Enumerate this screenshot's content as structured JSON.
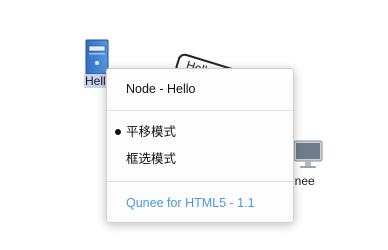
{
  "graph": {
    "server_node": {
      "icon": "server-icon",
      "label": "Hell"
    },
    "tag_node": {
      "text": "Hello"
    },
    "monitor_node": {
      "icon": "monitor-icon",
      "label": "unee"
    }
  },
  "context_menu": {
    "title_item": "Node - Hello",
    "items": [
      {
        "label": "平移模式",
        "selected": true
      },
      {
        "label": "框选模式",
        "selected": false
      }
    ],
    "version_item": "Qunee for HTML5 - 1.1"
  },
  "colors": {
    "accent": "#4a9ad9",
    "selection_bg": "#c8d3f0",
    "server_blue": "#3b78c8"
  }
}
